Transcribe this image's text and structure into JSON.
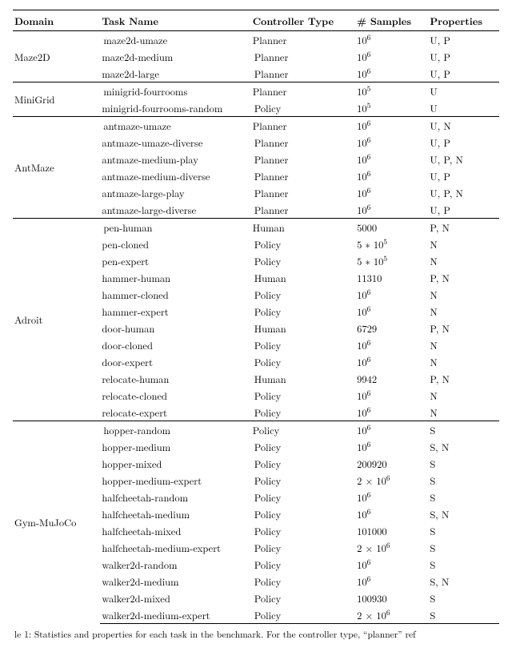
{
  "headers": {
    "domain": "Domain",
    "task": "Task Name",
    "controller": "Controller Type",
    "samples": "# Samples",
    "properties": "Properties"
  },
  "chart_data": {
    "type": "table",
    "title": "",
    "columns": [
      "Domain",
      "Task Name",
      "Controller Type",
      "# Samples",
      "Properties"
    ],
    "sections": [
      {
        "domain": "Maze2D",
        "rows": [
          {
            "task": "maze2d-umaze",
            "controller": "Planner",
            "samples_html": "10<sup>6</sup>",
            "samples_value": 1000000,
            "properties": "U, P"
          },
          {
            "task": "maze2d-medium",
            "controller": "Planner",
            "samples_html": "10<sup>6</sup>",
            "samples_value": 1000000,
            "properties": "U, P"
          },
          {
            "task": "maze2d-large",
            "controller": "Planner",
            "samples_html": "10<sup>6</sup>",
            "samples_value": 1000000,
            "properties": "U, P"
          }
        ]
      },
      {
        "domain": "MiniGrid",
        "rows": [
          {
            "task": "minigrid-fourrooms",
            "controller": "Planner",
            "samples_html": "10<sup>5</sup>",
            "samples_value": 100000,
            "properties": "U"
          },
          {
            "task": "minigrid-fourrooms-random",
            "controller": "Policy",
            "samples_html": "10<sup>5</sup>",
            "samples_value": 100000,
            "properties": "U"
          }
        ]
      },
      {
        "domain": "AntMaze",
        "rows": [
          {
            "task": "antmaze-umaze",
            "controller": "Planner",
            "samples_html": "10<sup>6</sup>",
            "samples_value": 1000000,
            "properties": "U, N"
          },
          {
            "task": "antmaze-umaze-diverse",
            "controller": "Planner",
            "samples_html": "10<sup>6</sup>",
            "samples_value": 1000000,
            "properties": "U, P"
          },
          {
            "task": "antmaze-medium-play",
            "controller": "Planner",
            "samples_html": "10<sup>6</sup>",
            "samples_value": 1000000,
            "properties": "U, P, N"
          },
          {
            "task": "antmaze-medium-diverse",
            "controller": "Planner",
            "samples_html": "10<sup>6</sup>",
            "samples_value": 1000000,
            "properties": "U, P"
          },
          {
            "task": "antmaze-large-play",
            "controller": "Planner",
            "samples_html": "10<sup>6</sup>",
            "samples_value": 1000000,
            "properties": "U, P, N"
          },
          {
            "task": "antmaze-large-diverse",
            "controller": "Planner",
            "samples_html": "10<sup>6</sup>",
            "samples_value": 1000000,
            "properties": "U, P"
          }
        ]
      },
      {
        "domain": "Adroit",
        "rows": [
          {
            "task": "pen-human",
            "controller": "Human",
            "samples_html": "5000",
            "samples_value": 5000,
            "properties": "P, N"
          },
          {
            "task": "pen-cloned",
            "controller": "Policy",
            "samples_html": "5 ∗ 10<sup>5</sup>",
            "samples_value": 500000,
            "properties": "N"
          },
          {
            "task": "pen-expert",
            "controller": "Policy",
            "samples_html": "5 ∗ 10<sup>5</sup>",
            "samples_value": 500000,
            "properties": "N"
          },
          {
            "task": "hammer-human",
            "controller": "Human",
            "samples_html": "11310",
            "samples_value": 11310,
            "properties": "P, N"
          },
          {
            "task": "hammer-cloned",
            "controller": "Policy",
            "samples_html": "10<sup>6</sup>",
            "samples_value": 1000000,
            "properties": "N"
          },
          {
            "task": "hammer-expert",
            "controller": "Policy",
            "samples_html": "10<sup>6</sup>",
            "samples_value": 1000000,
            "properties": "N"
          },
          {
            "task": "door-human",
            "controller": "Human",
            "samples_html": "6729",
            "samples_value": 6729,
            "properties": "P, N"
          },
          {
            "task": "door-cloned",
            "controller": "Policy",
            "samples_html": "10<sup>6</sup>",
            "samples_value": 1000000,
            "properties": "N"
          },
          {
            "task": "door-expert",
            "controller": "Policy",
            "samples_html": "10<sup>6</sup>",
            "samples_value": 1000000,
            "properties": "N"
          },
          {
            "task": "relocate-human",
            "controller": "Human",
            "samples_html": "9942",
            "samples_value": 9942,
            "properties": "P, N"
          },
          {
            "task": "relocate-cloned",
            "controller": "Policy",
            "samples_html": "10<sup>6</sup>",
            "samples_value": 1000000,
            "properties": "N"
          },
          {
            "task": "relocate-expert",
            "controller": "Policy",
            "samples_html": "10<sup>6</sup>",
            "samples_value": 1000000,
            "properties": "N"
          }
        ]
      },
      {
        "domain": "Gym-MuJoCo",
        "rows": [
          {
            "task": "hopper-random",
            "controller": "Policy",
            "samples_html": "10<sup>6</sup>",
            "samples_value": 1000000,
            "properties": "S"
          },
          {
            "task": "hopper-medium",
            "controller": "Policy",
            "samples_html": "10<sup>6</sup>",
            "samples_value": 1000000,
            "properties": "S, N"
          },
          {
            "task": "hopper-mixed",
            "controller": "Policy",
            "samples_html": "200920",
            "samples_value": 200920,
            "properties": "S"
          },
          {
            "task": "hopper-medium-expert",
            "controller": "Policy",
            "samples_html": "2 × 10<sup>6</sup>",
            "samples_value": 2000000,
            "properties": "S"
          },
          {
            "task": "halfcheetah-random",
            "controller": "Policy",
            "samples_html": "10<sup>6</sup>",
            "samples_value": 1000000,
            "properties": "S"
          },
          {
            "task": "halfcheetah-medium",
            "controller": "Policy",
            "samples_html": "10<sup>6</sup>",
            "samples_value": 1000000,
            "properties": "S, N"
          },
          {
            "task": "halfcheetah-mixed",
            "controller": "Policy",
            "samples_html": "101000",
            "samples_value": 101000,
            "properties": "S"
          },
          {
            "task": "halfcheetah-medium-expert",
            "controller": "Policy",
            "samples_html": "2 × 10<sup>6</sup>",
            "samples_value": 2000000,
            "properties": "S"
          },
          {
            "task": "walker2d-random",
            "controller": "Policy",
            "samples_html": "10<sup>6</sup>",
            "samples_value": 1000000,
            "properties": "S"
          },
          {
            "task": "walker2d-medium",
            "controller": "Policy",
            "samples_html": "10<sup>6</sup>",
            "samples_value": 1000000,
            "properties": "S, N"
          },
          {
            "task": "walker2d-mixed",
            "controller": "Policy",
            "samples_html": "100930",
            "samples_value": 100930,
            "properties": "S"
          },
          {
            "task": "walker2d-medium-expert",
            "controller": "Policy",
            "samples_html": "2 × 10<sup>6</sup>",
            "samples_value": 2000000,
            "properties": "S"
          }
        ]
      }
    ]
  },
  "caption": "le 1: Statistics and properties for each task in the benchmark. For the controller type, “planner” ref"
}
